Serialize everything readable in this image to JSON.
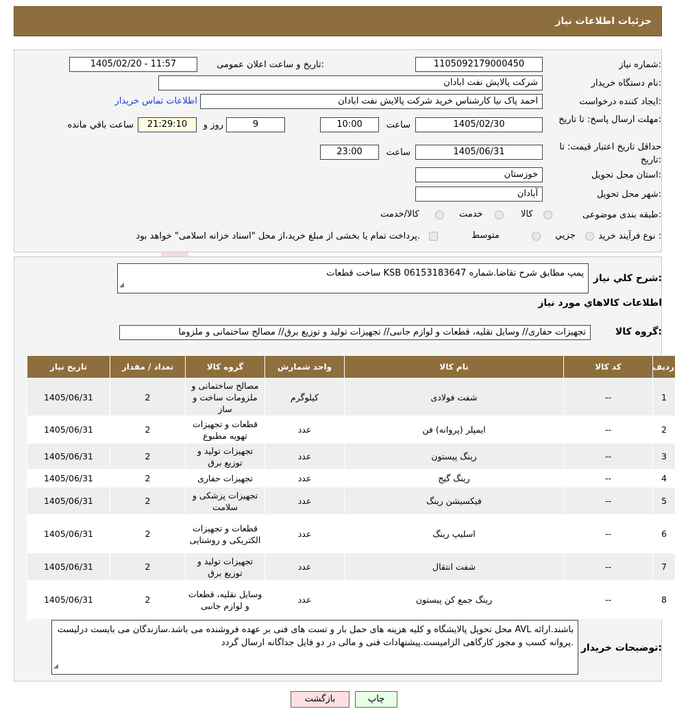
{
  "header": {
    "title": "جزئیات اطلاعات نیاز"
  },
  "form": {
    "need_number_label": "شماره نیاز:",
    "need_number": "1105092179000450",
    "announce_label": "تاریخ و ساعت اعلان عمومی:",
    "announce_value": "1405/02/20 - 11:57",
    "buyer_label": "نام دستگاه خریدار:",
    "buyer_value": "شرکت پالایش نفت ابادان",
    "creator_label": "ایجاد کننده درخواست:",
    "creator_value": "احمد پاک نیا کارشناس خرید شرکت پالایش نفت ابادان",
    "contact_link": "اطلاعات تماس خریدار",
    "deadline_label": "مهلت ارسال پاسخ: تا تاریخ:",
    "deadline_date": "1405/02/30",
    "time_label": "ساعت",
    "deadline_time": "10:00",
    "days_value": "9",
    "days_label": "روز و",
    "remaining_time": "21:29:10",
    "remaining_label": "ساعت باقي مانده",
    "validity_label": "حداقل تاریخ اعتبار قیمت: تا تاریخ:",
    "validity_date": "1405/06/31",
    "validity_time": "23:00",
    "province_label": "استان محل تحویل:",
    "province_value": "خوزستان",
    "city_label": "شهر محل تحویل:",
    "city_value": "آبادان",
    "category_label": "طبقه بندی موضوعی:",
    "category_options": [
      "کالا",
      "خدمت",
      "کالا/خدمت"
    ],
    "purchase_label": "نوع فرآیند خرید :",
    "purchase_options": [
      "جزیي",
      "متوسط"
    ],
    "purchase_note": "پرداخت تمام یا بخشی از مبلغ خرید،از محل \"اسناد خزانه اسلامی\" خواهد بود."
  },
  "summary": {
    "desc_label": "شرح کلي نياز:",
    "desc_value": "ساخت قطعات KSB پمپ مطابق شرح تقاضا.شماره 06153183647",
    "goods_title": "اطلاعات کالاهاي مورد نياز",
    "group_label": "گروه کالا:",
    "group_value": "تجهیزات حفاری// وسایل نقلیه، قطعات و لوازم جانبی// تجهیزات تولید و توزیع برق// مصالح ساختمانی و ملزوما"
  },
  "table": {
    "headers": [
      "رديف",
      "کد کالا",
      "نام کالا",
      "واحد شمارش",
      "گروه کالا",
      "تعداد / مقدار",
      "تاریخ نیاز"
    ],
    "rows": [
      [
        "1",
        "--",
        "شفت فولادی",
        "کیلوگرم",
        "مصالح ساختمانی و ملزومات ساخت و ساز",
        "2",
        "1405/06/31"
      ],
      [
        "2",
        "--",
        "ایمپلر (پروانه) فن",
        "عدد",
        "قطعات و تجهیزات تهویه مطبوع",
        "2",
        "1405/06/31"
      ],
      [
        "3",
        "--",
        "رینگ پیستون",
        "عدد",
        "تجهیزات تولید و توزیع برق",
        "2",
        "1405/06/31"
      ],
      [
        "4",
        "--",
        "رینگ گیج",
        "عدد",
        "تجهیزات حفاری",
        "2",
        "1405/06/31"
      ],
      [
        "5",
        "--",
        "فیکسیشن رینگ",
        "عدد",
        "تجهیزات پزشکی و سلامت",
        "2",
        "1405/06/31"
      ],
      [
        "6",
        "--",
        "اسلیپ رینگ",
        "عدد",
        "قطعات و تجهیزات الکتریکی و روشنایی",
        "2",
        "1405/06/31"
      ],
      [
        "7",
        "--",
        "شفت انتقال",
        "عدد",
        "تجهیزات تولید و توزیع برق",
        "2",
        "1405/06/31"
      ],
      [
        "8",
        "--",
        "رینگ جمع کن پیستون",
        "عدد",
        "وسایل نقلیه، قطعات و لوازم جانبی",
        "2",
        "1405/06/31"
      ]
    ]
  },
  "notes": {
    "label": "توضیحات خریدار:",
    "value": "محل تحویل پالایشگاه و کلیه هزینه های حمل بار و تست های فنی بر عهده فروشنده می باشد.سازندگان می بایست درلیست AVL باشند.ارائه پروانه کسب و مجوز کارگاهی الزامیست.پیشنهادات فنی و مالی در دو فایل جداگانه ارسال گردد."
  },
  "buttons": {
    "print": "چاپ",
    "back": "بازگشت"
  },
  "colors": {
    "header": "#8e6e3d",
    "link": "#1a3fd8",
    "back_button": "#ffe0e0",
    "print_button": "#e8ffe8"
  }
}
